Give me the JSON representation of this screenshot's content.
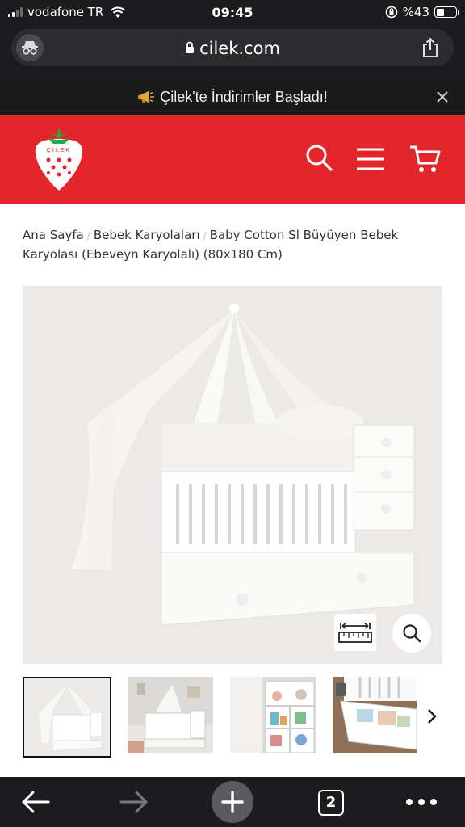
{
  "status_bar": {
    "carrier": "vodafone TR",
    "time": "09:45",
    "battery_text": "%43",
    "battery_level": 0.43
  },
  "browser": {
    "url": "cilek.com"
  },
  "promo": {
    "icon": "megaphone-icon",
    "text": "Çilek'te İndirimler Başladı!"
  },
  "header": {
    "logo_text": "ÇİLEK",
    "brand_color": "#e4262a"
  },
  "breadcrumb": {
    "items": [
      "Ana Sayfa",
      "Bebek Karyolaları",
      "Baby Cotton Sl Büyüyen Bebek Karyolası (Ebeveyn Karyolalı) (80x180 Cm)"
    ],
    "separator": "/"
  },
  "gallery": {
    "thumbnail_count": 4,
    "active_index": 0
  },
  "toolbar": {
    "tab_count": "2"
  }
}
